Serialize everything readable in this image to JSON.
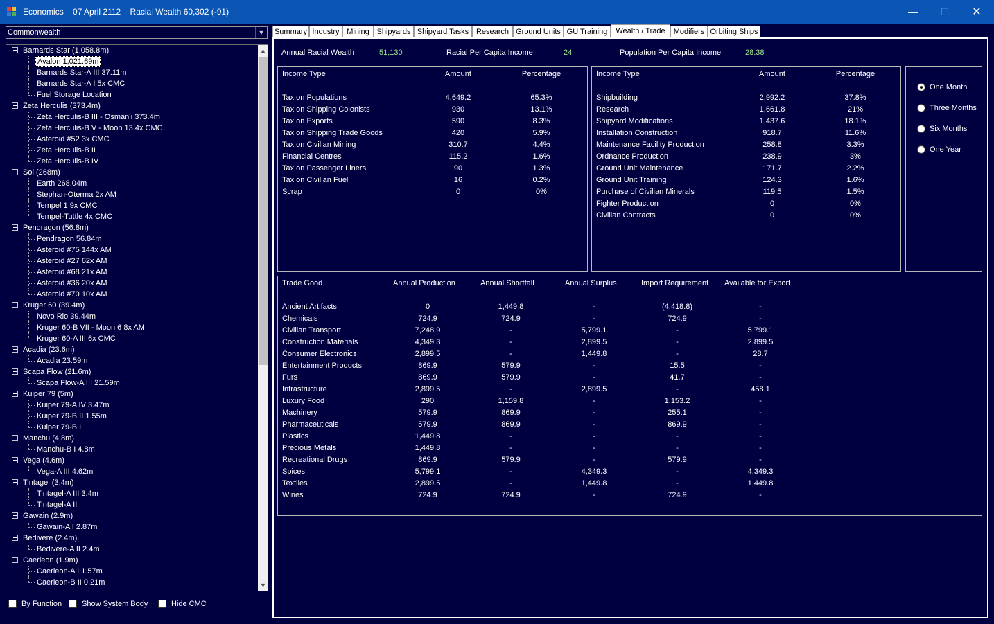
{
  "window": {
    "app_name": "Economics",
    "date": "07 April 2112",
    "wealth_label": "Racial Wealth 60,302 (-91)",
    "controls": [
      "minimize-icon",
      "maximize-icon",
      "close-icon"
    ]
  },
  "race_select": {
    "value": "Commonwealth"
  },
  "tree": [
    {
      "type": "system",
      "label": "Barnards Star  (1,058.8m)"
    },
    {
      "type": "body",
      "label": "Avalon  1,021.69m",
      "selected": true
    },
    {
      "type": "body",
      "label": "Barnards Star-A III  37.11m"
    },
    {
      "type": "body",
      "label": "Barnards Star-A I  5x CMC"
    },
    {
      "type": "body",
      "label": "Fuel Storage Location"
    },
    {
      "type": "system",
      "label": "Zeta Herculis  (373.4m)"
    },
    {
      "type": "body",
      "label": "Zeta Herculis-B III - Osmanli  373.4m"
    },
    {
      "type": "body",
      "label": "Zeta Herculis-B V - Moon 13  4x CMC"
    },
    {
      "type": "body",
      "label": "Asteroid #52  3x CMC"
    },
    {
      "type": "body",
      "label": "Zeta Herculis-B II"
    },
    {
      "type": "body",
      "label": "Zeta Herculis-B IV"
    },
    {
      "type": "system",
      "label": "Sol  (268m)"
    },
    {
      "type": "body",
      "label": "Earth  268.04m"
    },
    {
      "type": "body",
      "label": "Stephan-Oterma  2x AM"
    },
    {
      "type": "body",
      "label": "Tempel 1  9x CMC"
    },
    {
      "type": "body",
      "label": "Tempel-Tuttle  4x CMC"
    },
    {
      "type": "system",
      "label": "Pendragon  (56.8m)"
    },
    {
      "type": "body",
      "label": "Pendragon  56.84m"
    },
    {
      "type": "body",
      "label": "Asteroid #75  144x AM"
    },
    {
      "type": "body",
      "label": "Asteroid #27  62x AM"
    },
    {
      "type": "body",
      "label": "Asteroid #68  21x AM"
    },
    {
      "type": "body",
      "label": "Asteroid #36  20x AM"
    },
    {
      "type": "body",
      "label": "Asteroid #70  10x AM"
    },
    {
      "type": "system",
      "label": "Kruger 60  (39.4m)"
    },
    {
      "type": "body",
      "label": "Novo Rio  39.44m"
    },
    {
      "type": "body",
      "label": "Kruger 60-B VII - Moon 6  8x AM"
    },
    {
      "type": "body",
      "label": "Kruger 60-A III  6x CMC"
    },
    {
      "type": "system",
      "label": "Acadia  (23.6m)"
    },
    {
      "type": "body",
      "label": "Acadia  23.59m"
    },
    {
      "type": "system",
      "label": "Scapa Flow  (21.6m)"
    },
    {
      "type": "body",
      "label": "Scapa Flow-A III  21.59m"
    },
    {
      "type": "system",
      "label": "Kuiper 79  (5m)"
    },
    {
      "type": "body",
      "label": "Kuiper 79-A IV  3.47m"
    },
    {
      "type": "body",
      "label": "Kuiper 79-B II  1.55m"
    },
    {
      "type": "body",
      "label": "Kuiper 79-B I"
    },
    {
      "type": "system",
      "label": "Manchu  (4.8m)"
    },
    {
      "type": "body",
      "label": "Manchu-B I  4.8m"
    },
    {
      "type": "system",
      "label": "Vega  (4.6m)"
    },
    {
      "type": "body",
      "label": "Vega-A III  4.62m"
    },
    {
      "type": "system",
      "label": "Tintagel  (3.4m)"
    },
    {
      "type": "body",
      "label": "Tintagel-A III  3.4m"
    },
    {
      "type": "body",
      "label": "Tintagel-A II"
    },
    {
      "type": "system",
      "label": "Gawain  (2.9m)"
    },
    {
      "type": "body",
      "label": "Gawain-A I  2.87m"
    },
    {
      "type": "system",
      "label": "Bedivere  (2.4m)"
    },
    {
      "type": "body",
      "label": "Bedivere-A II  2.4m"
    },
    {
      "type": "system",
      "label": "Caerleon  (1.9m)"
    },
    {
      "type": "body",
      "label": "Caerleon-A I  1.57m"
    },
    {
      "type": "body",
      "label": "Caerleon-B II  0.21m"
    }
  ],
  "checkboxes": [
    {
      "label": "By Function",
      "checked": false
    },
    {
      "label": "Show System Body",
      "checked": false
    },
    {
      "label": "Hide CMC",
      "checked": false
    }
  ],
  "tabs": [
    {
      "label": "Summary"
    },
    {
      "label": "Industry"
    },
    {
      "label": "Mining"
    },
    {
      "label": "Shipyards"
    },
    {
      "label": "Shipyard Tasks"
    },
    {
      "label": "Research"
    },
    {
      "label": "Ground Units"
    },
    {
      "label": "GU Training"
    },
    {
      "label": "Wealth / Trade",
      "active": true
    },
    {
      "label": "Modifiers"
    },
    {
      "label": "Orbiting Ships"
    }
  ],
  "summary": {
    "annual_wealth_label": "Annual Racial Wealth",
    "annual_wealth_value": "51,130",
    "per_capita_label": "Racial Per Capita Income",
    "per_capita_value": "24",
    "pop_per_capita_label": "Population Per Capita Income",
    "pop_per_capita_value": "28.38"
  },
  "income": {
    "headers": [
      "Income Type",
      "Amount",
      "Percentage"
    ],
    "rows": [
      [
        "Tax on Populations",
        "4,649.2",
        "65.3%"
      ],
      [
        "Tax on Shipping Colonists",
        "930",
        "13.1%"
      ],
      [
        "Tax on Exports",
        "590",
        "8.3%"
      ],
      [
        "Tax on Shipping Trade Goods",
        "420",
        "5.9%"
      ],
      [
        "Tax on Civilian Mining",
        "310.7",
        "4.4%"
      ],
      [
        "Financial Centres",
        "115.2",
        "1.6%"
      ],
      [
        "Tax on Passenger Liners",
        "90",
        "1.3%"
      ],
      [
        "Tax on Civilian Fuel",
        "16",
        "0.2%"
      ],
      [
        "Scrap",
        "0",
        "0%"
      ]
    ]
  },
  "expense": {
    "headers": [
      "Income Type",
      "Amount",
      "Percentage"
    ],
    "rows": [
      [
        "Shipbuilding",
        "2,992.2",
        "37.8%"
      ],
      [
        "Research",
        "1,661.8",
        "21%"
      ],
      [
        "Shipyard Modifications",
        "1,437.6",
        "18.1%"
      ],
      [
        "Installation Construction",
        "918.7",
        "11.6%"
      ],
      [
        "Maintenance Facility Production",
        "258.8",
        "3.3%"
      ],
      [
        "Ordnance Production",
        "238.9",
        "3%"
      ],
      [
        "Ground Unit Maintenance",
        "171.7",
        "2.2%"
      ],
      [
        "Ground Unit Training",
        "124.3",
        "1.6%"
      ],
      [
        "Purchase of Civilian Minerals",
        "119.5",
        "1.5%"
      ],
      [
        "Fighter Production",
        "0",
        "0%"
      ],
      [
        "Civilian Contracts",
        "0",
        "0%"
      ]
    ]
  },
  "periods": [
    {
      "label": "One Month",
      "selected": true
    },
    {
      "label": "Three Months",
      "selected": false
    },
    {
      "label": "Six Months",
      "selected": false
    },
    {
      "label": "One Year",
      "selected": false
    }
  ],
  "trade": {
    "headers": [
      "Trade Good",
      "Annual Production",
      "Annual Shortfall",
      "Annual Surplus",
      "Import Requirement",
      "Available for Export"
    ],
    "rows": [
      [
        "Ancient Artifacts",
        "0",
        "1,449.8",
        "-",
        "(4,418.8)",
        "-"
      ],
      [
        "Chemicals",
        "724.9",
        "724.9",
        "-",
        "724.9",
        "-"
      ],
      [
        "Civilian Transport",
        "7,248.9",
        "-",
        "5,799.1",
        "-",
        "5,799.1"
      ],
      [
        "Construction Materials",
        "4,349.3",
        "-",
        "2,899.5",
        "-",
        "2,899.5"
      ],
      [
        "Consumer Electronics",
        "2,899.5",
        "-",
        "1,449.8",
        "-",
        "28.7"
      ],
      [
        "Entertainment Products",
        "869.9",
        "579.9",
        "-",
        "15.5",
        "-"
      ],
      [
        "Furs",
        "869.9",
        "579.9",
        "-",
        "41.7",
        "-"
      ],
      [
        "Infrastructure",
        "2,899.5",
        "-",
        "2,899.5",
        "-",
        "458.1"
      ],
      [
        "Luxury Food",
        "290",
        "1,159.8",
        "-",
        "1,153.2",
        "-"
      ],
      [
        "Machinery",
        "579.9",
        "869.9",
        "-",
        "255.1",
        "-"
      ],
      [
        "Pharmaceuticals",
        "579.9",
        "869.9",
        "-",
        "869.9",
        "-"
      ],
      [
        "Plastics",
        "1,449.8",
        "-",
        "-",
        "-",
        "-"
      ],
      [
        "Precious Metals",
        "1,449.8",
        "-",
        "-",
        "-",
        "-"
      ],
      [
        "Recreational Drugs",
        "869.9",
        "579.9",
        "-",
        "579.9",
        "-"
      ],
      [
        "Spices",
        "5,799.1",
        "-",
        "4,349.3",
        "-",
        "4,349.3"
      ],
      [
        "Textiles",
        "2,899.5",
        "-",
        "1,449.8",
        "-",
        "1,449.8"
      ],
      [
        "Wines",
        "724.9",
        "724.9",
        "-",
        "724.9",
        "-"
      ]
    ]
  },
  "colors": {
    "background": "#000040",
    "titlebar": "#0b55b5",
    "value_green": "#9be28c"
  }
}
